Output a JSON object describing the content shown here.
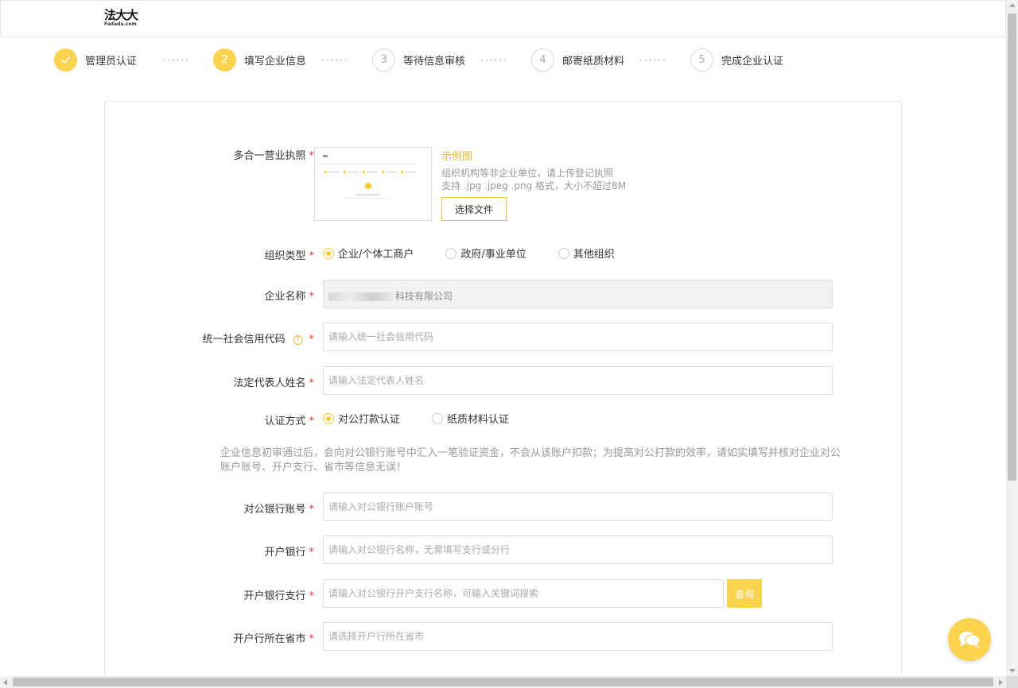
{
  "brand": {
    "logo_text": "法大大",
    "logo_sub": "Fadada.com",
    "accent_color": "#fcca2a"
  },
  "steps": [
    {
      "number": "✓",
      "label": "管理员认证",
      "state": "done"
    },
    {
      "number": "2",
      "label": "填写企业信息",
      "state": "active"
    },
    {
      "number": "3",
      "label": "等待信息审核",
      "state": "pending"
    },
    {
      "number": "4",
      "label": "邮寄纸质材料",
      "state": "pending"
    },
    {
      "number": "5",
      "label": "完成企业认证",
      "state": "pending"
    }
  ],
  "step_separator": "······",
  "form": {
    "required_mark": "*",
    "license": {
      "label": "多合一营业执照",
      "example_link": "示例图",
      "hint_1": "组织机构等非企业单位，请上传登记执照",
      "hint_2": "支持 .jpg .jpeg .png 格式，大小不超过8M",
      "button": "选择文件"
    },
    "org_type": {
      "label": "组织类型",
      "options": [
        "企业/个体工商户",
        "政府/事业单位",
        "其他组织"
      ],
      "selected": "企业/个体工商户"
    },
    "company_name": {
      "label": "企业名称",
      "value": "科技有限公司"
    },
    "credit_code": {
      "label": "统一社会信用代码",
      "help": "?",
      "placeholder": "请输入统一社会信用代码"
    },
    "legal_rep": {
      "label": "法定代表人姓名",
      "placeholder": "请输入法定代表人姓名"
    },
    "auth_method": {
      "label": "认证方式",
      "options": [
        "对公打款认证",
        "纸质材料认证"
      ],
      "selected": "对公打款认证"
    },
    "notice": "企业信息初审通过后，会向对公银行账号中汇入一笔验证资金，不会从该账户扣款；为提高对公打款的效率，请如实填写并核对企业对公账户账号、开户支行、省市等信息无误！",
    "bank_account": {
      "label": "对公银行账号",
      "placeholder": "请输入对公银行账户账号"
    },
    "bank_name": {
      "label": "开户银行",
      "placeholder": "请输入对公银行名称，无需填写支行或分行"
    },
    "bank_branch": {
      "label": "开户银行支行",
      "placeholder": "请输入对公银行开户支行名称，可输入关键词搜索",
      "query_button": "查询"
    },
    "bank_city": {
      "label": "开户行所在省市",
      "placeholder": "请选择开户行所在省市"
    }
  },
  "chat": {
    "icon": "chat-bubbles-icon"
  }
}
